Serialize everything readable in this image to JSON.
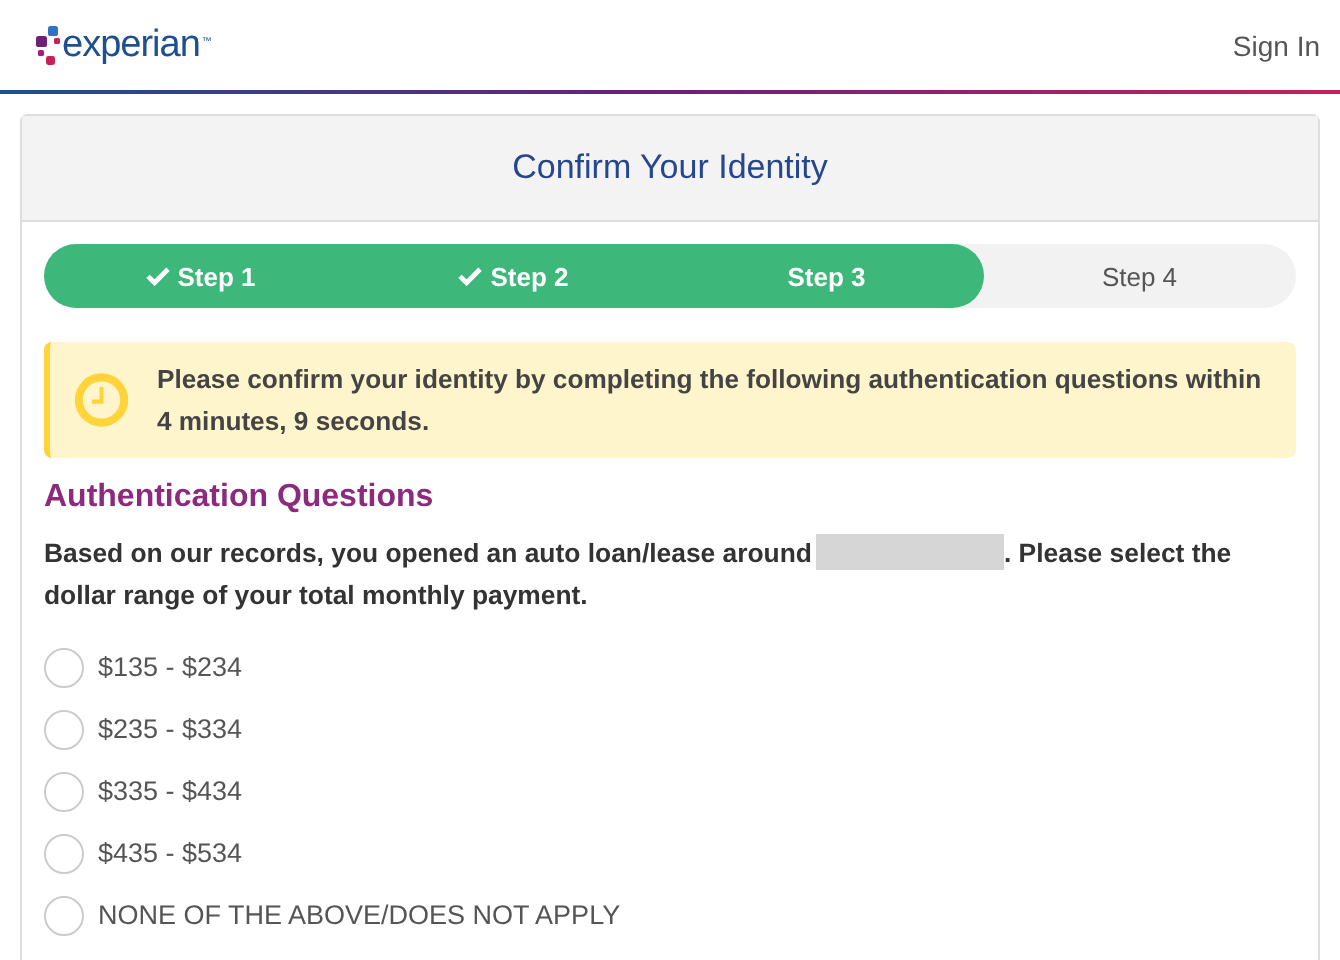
{
  "header": {
    "logo": "experian",
    "logo_mark": "™",
    "sign_in": "Sign In"
  },
  "card": {
    "title": "Confirm Your Identity"
  },
  "steps": [
    {
      "label": "Step 1",
      "completed": true,
      "selected": false
    },
    {
      "label": "Step 2",
      "completed": true,
      "selected": false
    },
    {
      "label": "Step 3",
      "completed": false,
      "selected": true
    },
    {
      "label": "Step 4",
      "completed": false,
      "selected": false
    }
  ],
  "alert": {
    "text": "Please confirm your identity by completing the following authentication questions within 4 minutes, 9 seconds."
  },
  "section_title": "Authentication Questions",
  "question": {
    "before": "Based on our records, you opened an auto loan/lease around",
    "after": ". Please select the dollar range of your total monthly payment."
  },
  "options": [
    {
      "label": "$135 - $234",
      "selected": false
    },
    {
      "label": "$235 - $334",
      "selected": false
    },
    {
      "label": "$335 - $434",
      "selected": false
    },
    {
      "label": "$435 - $534",
      "selected": false
    },
    {
      "label": "NONE OF THE ABOVE/DOES NOT APPLY",
      "selected": false
    }
  ]
}
